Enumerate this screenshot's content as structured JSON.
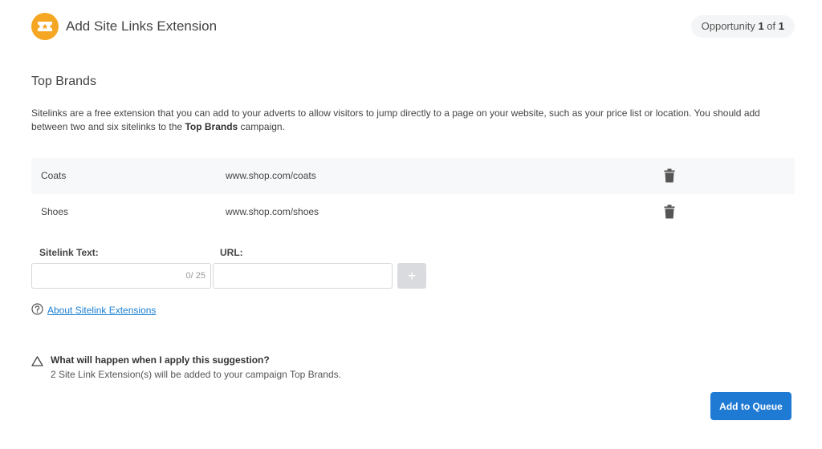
{
  "header": {
    "title": "Add Site Links Extension",
    "opportunity_prefix": "Opportunity ",
    "opportunity_current": "1",
    "opportunity_sep": " of ",
    "opportunity_total": "1",
    "icon": "ticket-icon",
    "icon_color": "#f5a623"
  },
  "section": {
    "title": "Top Brands",
    "description_before": "Sitelinks are a free extension that you can add to your adverts to allow visitors to jump directly to a page on your website, such as your price list or location. You should add between two and six sitelinks to the ",
    "description_campaign": "Top Brands",
    "description_after": " campaign."
  },
  "sitelinks": [
    {
      "text": "Coats",
      "url": "www.shop.com/coats"
    },
    {
      "text": "Shoes",
      "url": "www.shop.com/shoes"
    }
  ],
  "form": {
    "sitelink_text_label": "Sitelink Text:",
    "url_label": "URL:",
    "sitelink_text_value": "",
    "url_value": "",
    "counter": "0/ 25",
    "add_label": "+"
  },
  "help": {
    "link_text": "About Sitelink Extensions"
  },
  "info": {
    "question": "What will happen when I apply this suggestion?",
    "answer": "2 Site Link Extension(s) will be added to your campaign Top Brands."
  },
  "actions": {
    "queue_label": "Add to Queue",
    "primary_color": "#1f7ad4"
  }
}
